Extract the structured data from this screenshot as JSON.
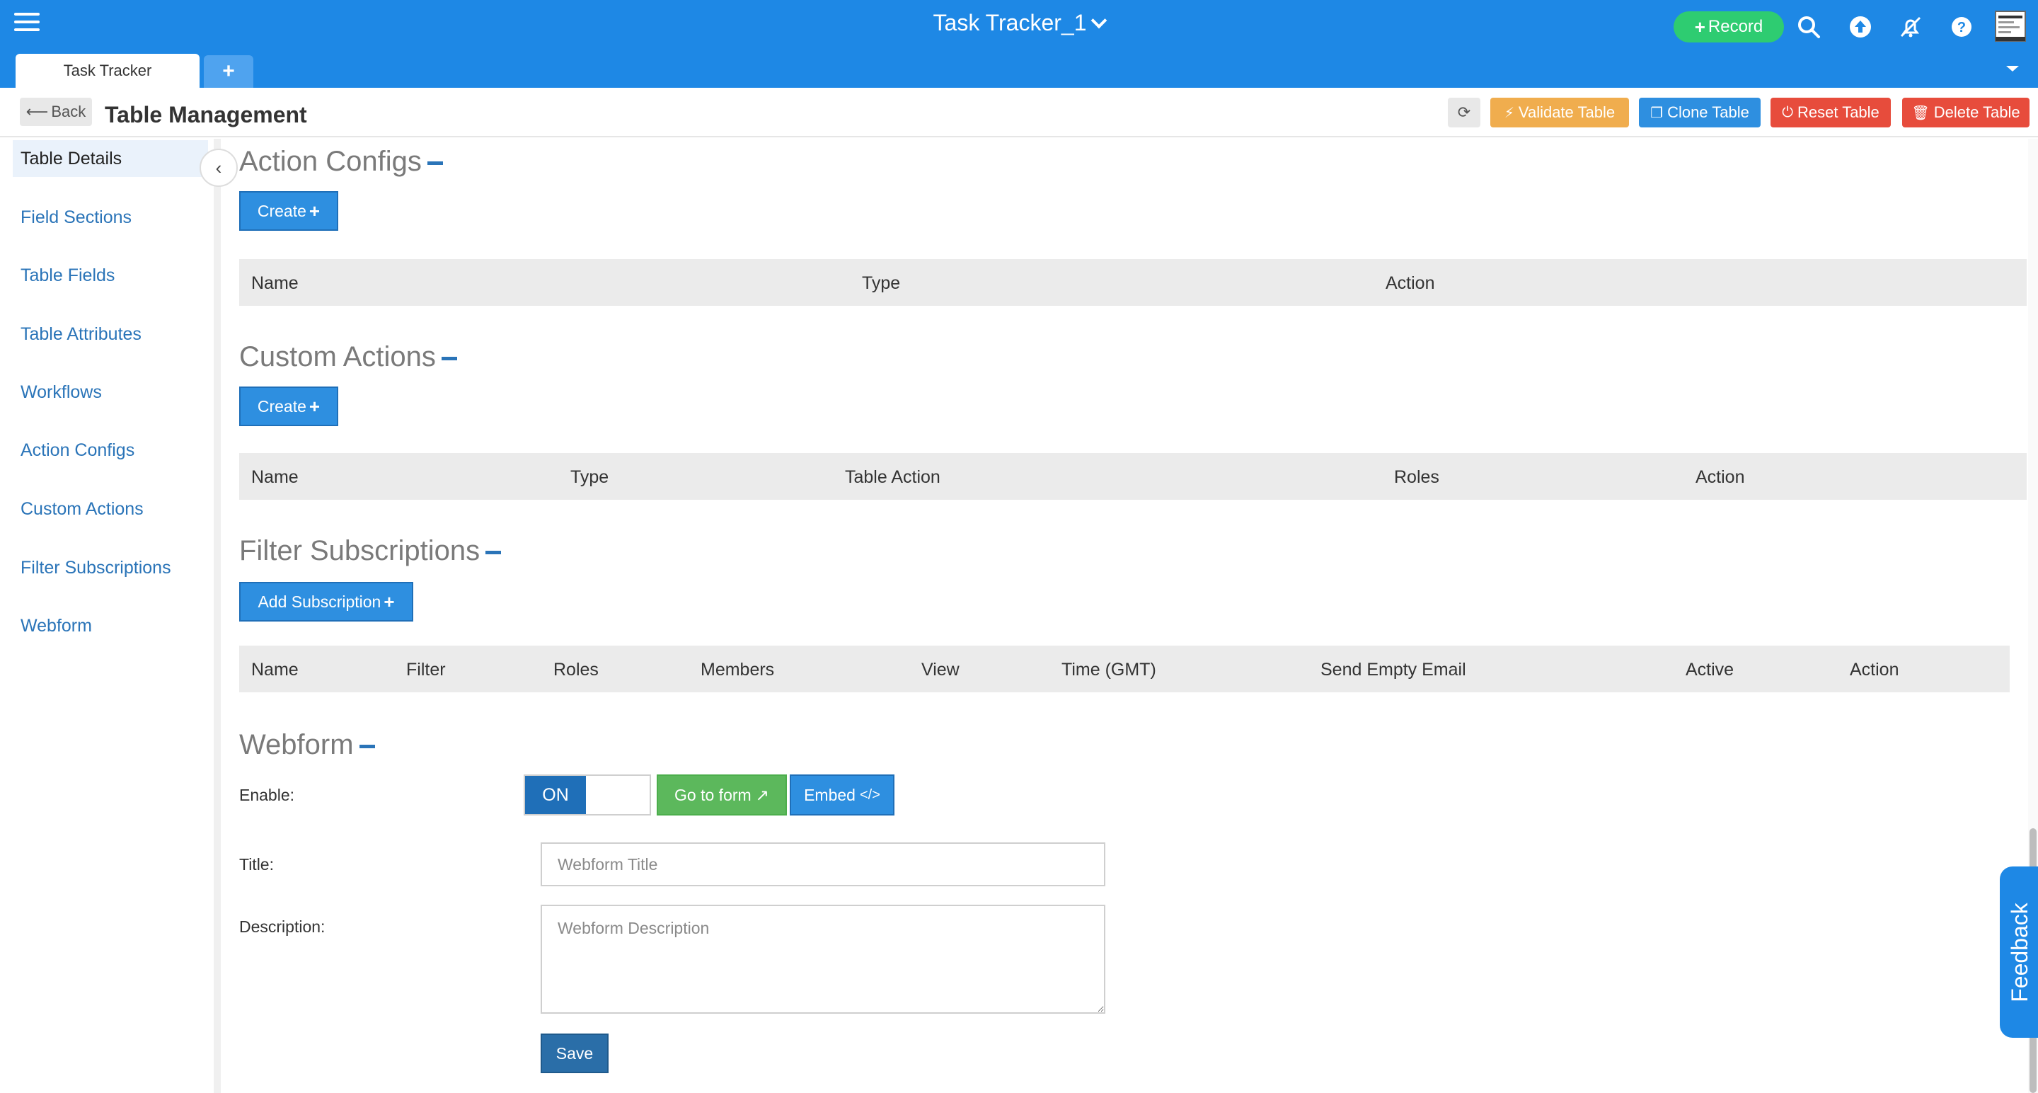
{
  "app": {
    "title": "Task Tracker_1",
    "record_label": "Record",
    "tabs": [
      {
        "label": "Task Tracker"
      }
    ],
    "add_tab_label": "+"
  },
  "header": {
    "back_label": "Back",
    "page_title": "Table Management",
    "validate_label": "Validate Table",
    "clone_label": "Clone Table",
    "reset_label": "Reset Table",
    "delete_label": "Delete Table"
  },
  "sidebar": {
    "items": [
      {
        "label": "Table Details"
      },
      {
        "label": "Field Sections"
      },
      {
        "label": "Table Fields"
      },
      {
        "label": "Table Attributes"
      },
      {
        "label": "Workflows"
      },
      {
        "label": "Action Configs"
      },
      {
        "label": "Custom Actions"
      },
      {
        "label": "Filter Subscriptions"
      },
      {
        "label": "Webform"
      }
    ]
  },
  "sections": {
    "action_configs": {
      "title": "Action Configs",
      "create_label": "Create",
      "columns": [
        "Name",
        "Type",
        "Action"
      ]
    },
    "custom_actions": {
      "title": "Custom Actions",
      "create_label": "Create",
      "columns": [
        "Name",
        "Type",
        "Table Action",
        "Roles",
        "Action"
      ]
    },
    "filter_subscriptions": {
      "title": "Filter Subscriptions",
      "add_label": "Add Subscription",
      "columns": [
        "Name",
        "Filter",
        "Roles",
        "Members",
        "View",
        "Time (GMT)",
        "Send Empty Email",
        "Active",
        "Action"
      ]
    },
    "webform": {
      "title": "Webform",
      "enable_label": "Enable:",
      "toggle_on": "ON",
      "goto_label": "Go to form",
      "embed_label": "Embed",
      "title_label": "Title:",
      "title_placeholder": "Webform Title",
      "description_label": "Description:",
      "description_placeholder": "Webform Description",
      "save_label": "Save"
    }
  },
  "feedback_label": "Feedback",
  "colors": {
    "topbar": "#1e88e5",
    "record": "#2ecc71",
    "validate": "#f0ad4e",
    "clone": "#2e8fe0",
    "reset": "#e74c3c",
    "delete": "#e74c3c",
    "goto": "#5cb85c"
  }
}
